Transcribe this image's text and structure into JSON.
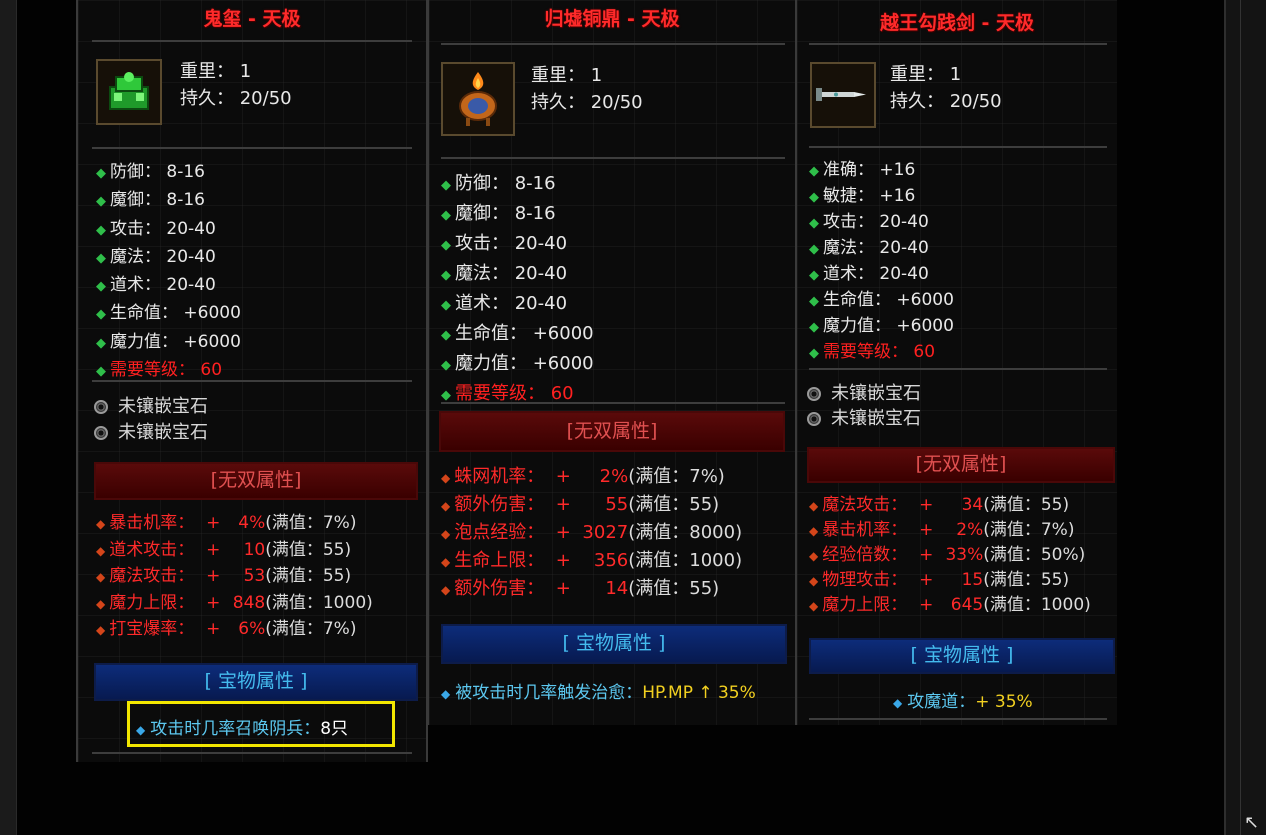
{
  "panels": [
    {
      "title": "鬼玺 - 天极",
      "item_icon": "green-jade-seal-icon",
      "basic": {
        "weight": "重里： 1",
        "durability": "持久： 20/50"
      },
      "stats": [
        {
          "label": "防御： 8-16",
          "red": false
        },
        {
          "label": "魔御： 8-16",
          "red": false
        },
        {
          "label": "攻击： 20-40",
          "red": false
        },
        {
          "label": "魔法： 20-40",
          "red": false
        },
        {
          "label": "道术： 20-40",
          "red": false
        },
        {
          "label": "生命值： +6000",
          "red": false
        },
        {
          "label": "魔力值： +6000",
          "red": false
        },
        {
          "label": "需要等级： 60",
          "red": true
        }
      ],
      "gems": [
        "未镶嵌宝石",
        "未镶嵌宝石"
      ],
      "unique_header": "[无双属性]",
      "unique_attrs": [
        {
          "name": "暴击机率：",
          "plus": "+",
          "value": "4%",
          "max": "(满值：7%)"
        },
        {
          "name": "道术攻击：",
          "plus": "+",
          "value": "10",
          "max": "(满值：55)"
        },
        {
          "name": "魔法攻击：",
          "plus": "+",
          "value": "53",
          "max": "(满值：55)"
        },
        {
          "name": "魔力上限：",
          "plus": "+",
          "value": "848",
          "max": "(满值：1000)"
        },
        {
          "name": "打宝爆率：",
          "plus": "+",
          "value": "6%",
          "max": "(满值：7%)"
        }
      ],
      "treasure_header": "[ 宝物属性 ]",
      "treasure": {
        "label": "攻击时几率召唤阴兵：",
        "value": "8只"
      }
    },
    {
      "title": "归墟铜鼎 - 天极",
      "item_icon": "bronze-cauldron-icon",
      "basic": {
        "weight": "重里： 1",
        "durability": "持久： 20/50"
      },
      "stats": [
        {
          "label": "防御： 8-16",
          "red": false
        },
        {
          "label": "魔御： 8-16",
          "red": false
        },
        {
          "label": "攻击： 20-40",
          "red": false
        },
        {
          "label": "魔法： 20-40",
          "red": false
        },
        {
          "label": "道术： 20-40",
          "red": false
        },
        {
          "label": "生命值： +6000",
          "red": false
        },
        {
          "label": "魔力值： +6000",
          "red": false
        },
        {
          "label": "需要等级： 60",
          "red": true
        }
      ],
      "unique_header": "[无双属性]",
      "unique_attrs": [
        {
          "name": "蛛网机率：",
          "plus": "+",
          "value": "2%",
          "max": "(满值：7%)"
        },
        {
          "name": "额外伤害：",
          "plus": "+",
          "value": "55",
          "max": "(满值：55)"
        },
        {
          "name": "泡点经验：",
          "plus": "+",
          "value": "3027",
          "max": "(满值：8000)"
        },
        {
          "name": "生命上限：",
          "plus": "+",
          "value": "356",
          "max": "(满值：1000)"
        },
        {
          "name": "额外伤害：",
          "plus": "+",
          "value": "14",
          "max": "(满值：55)"
        }
      ],
      "treasure_header": "[ 宝物属性 ]",
      "treasure": {
        "label": "被攻击时几率触发治愈：",
        "value": "HP.MP ↑ 35%"
      }
    },
    {
      "title": "越王勾践剑 - 天极",
      "item_icon": "sword-icon",
      "basic": {
        "weight": "重里： 1",
        "durability": "持久： 20/50"
      },
      "stats": [
        {
          "label": "准确： +16",
          "red": false
        },
        {
          "label": "敏捷： +16",
          "red": false
        },
        {
          "label": "攻击： 20-40",
          "red": false
        },
        {
          "label": "魔法： 20-40",
          "red": false
        },
        {
          "label": "道术： 20-40",
          "red": false
        },
        {
          "label": "生命值： +6000",
          "red": false
        },
        {
          "label": "魔力值： +6000",
          "red": false
        },
        {
          "label": "需要等级： 60",
          "red": true
        }
      ],
      "gems": [
        "未镶嵌宝石",
        "未镶嵌宝石"
      ],
      "unique_header": "[无双属性]",
      "unique_attrs": [
        {
          "name": "魔法攻击：",
          "plus": "+",
          "value": "34",
          "max": "(满值：55)"
        },
        {
          "name": "暴击机率：",
          "plus": "+",
          "value": "2%",
          "max": "(满值：7%)"
        },
        {
          "name": "经验倍数：",
          "plus": "+",
          "value": "33%",
          "max": "(满值：50%)"
        },
        {
          "name": "物理攻击：",
          "plus": "+",
          "value": "15",
          "max": "(满值：55)"
        },
        {
          "name": "魔力上限：",
          "plus": "+",
          "value": "645",
          "max": "(满值：1000)"
        }
      ],
      "treasure_header": "[ 宝物属性 ]",
      "treasure": {
        "label": "攻魔道：",
        "value": "+ 35%"
      }
    }
  ],
  "colors": {
    "title_red": "#ff2a2a",
    "highlight_box": "#f2e600",
    "treasure_blue": "#5cc8f0"
  }
}
